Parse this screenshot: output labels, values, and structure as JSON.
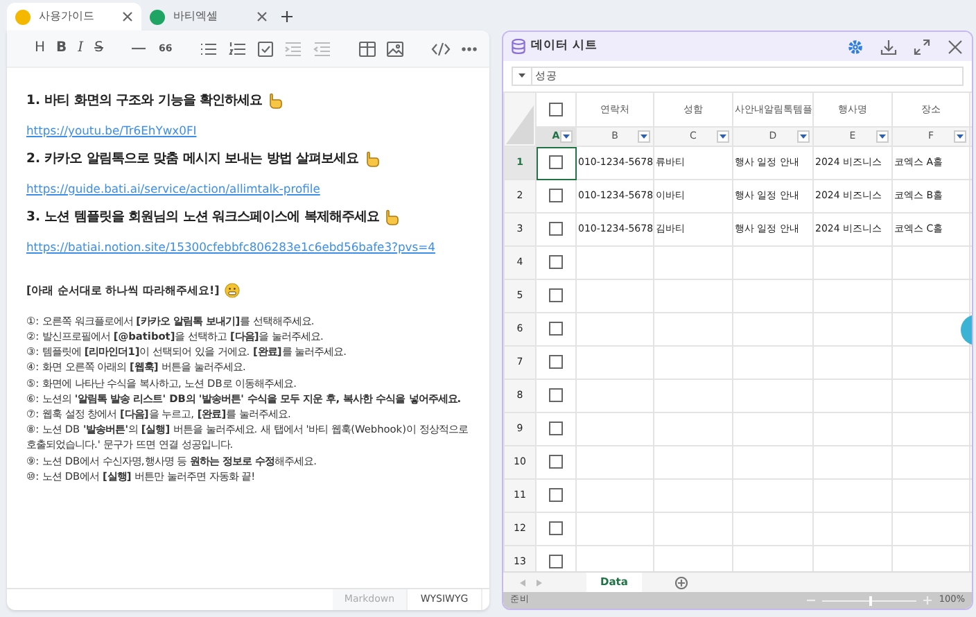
{
  "tabs": [
    {
      "label": "사용가이드",
      "selected": true,
      "color": "#f5b800"
    },
    {
      "label": "바티엑셀",
      "selected": false,
      "color": "#1fa463"
    }
  ],
  "editor": {
    "toolbar": [
      {
        "kind": "text",
        "label": "H"
      },
      {
        "kind": "bold",
        "label": "B"
      },
      {
        "kind": "italic",
        "label": "I"
      },
      {
        "kind": "strike",
        "label": "S"
      },
      {
        "kind": "sep"
      },
      {
        "kind": "line"
      },
      {
        "kind": "text",
        "label": "66"
      },
      {
        "kind": "sep"
      },
      {
        "kind": "bullet"
      },
      {
        "kind": "ordered"
      },
      {
        "kind": "task"
      },
      {
        "kind": "indent"
      },
      {
        "kind": "outdent"
      },
      {
        "kind": "sep"
      },
      {
        "kind": "table"
      },
      {
        "kind": "image"
      },
      {
        "kind": "sep"
      },
      {
        "kind": "code"
      },
      {
        "kind": "more"
      }
    ],
    "content": [
      {
        "kind": "heading",
        "text": "1. 바티 화면의 구조와 기능을 확인하세요"
      },
      {
        "kind": "link",
        "text": "https://youtu.be/Tr6EhYwx0FI"
      },
      {
        "kind": "heading",
        "text": "2. 카카오 알림톡으로 맞춤 메시지 보내는 방법 살펴보세요"
      },
      {
        "kind": "link",
        "text": "https://guide.bati.ai/service/action/allimtalk-profile"
      },
      {
        "kind": "heading",
        "text": "3. 노션 템플릿을 회원님의 노션 워크스페이스에 복제해주세요"
      },
      {
        "kind": "link",
        "text": "https://batiai.notion.site/15300cfebbfc806283e1c6ebd56bafe3?pvs=4"
      },
      {
        "kind": "note",
        "text": "[아래 순서대로 하나씩 따라해주세요!]"
      },
      {
        "kind": "step",
        "text": "①: 오른쪽 워크플로에서 **[카카오 알림톡 보내기]**를 선택해주세요."
      },
      {
        "kind": "step",
        "text": "②: 발신프로필에서 **[@batibot]**을 선택하고 **[다음]**을 눌러주세요."
      },
      {
        "kind": "step",
        "text": "③: 템플릿에 **[리마인더1]**이 선택되어 있을 거에요. **[완료]**를 눌러주세요."
      },
      {
        "kind": "step",
        "text": "④: 화면 오른쪽 아래의 **[웹훅]** 버튼을 눌러주세요."
      },
      {
        "kind": "step",
        "text": "⑤: 화면에 나타난 수식을 복사하고, 노션 DB로 이동해주세요."
      },
      {
        "kind": "step",
        "text": "⑥: 노션의 **'알림톡 발송 리스트' DB의 '발송버튼' 수식을 모두 지운 후, 복사한 수식을 넣어주세요.**"
      },
      {
        "kind": "step",
        "text": "⑦: 웹훅 설정 창에서 **[다음]**을 누르고, **[완료]**를 눌러주세요."
      },
      {
        "kind": "step",
        "text": "⑧: 노션 DB **'발송버튼'**의 **[실행]** 버튼을 눌러주세요. 새 탭에서 '바티 웹훅(Webhook)이 정상적으로 호출되었습니다.' 문구가 뜨면 연결 성공입니다."
      },
      {
        "kind": "step",
        "text": "⑨: 노션 DB에서 수신자명,행사명 등 **원하는 정보로 수정**해주세요."
      },
      {
        "kind": "step",
        "text": "⑩: 노션 DB에서 **[실행]** 버튼만 눌러주면 자동화 끝!"
      }
    ],
    "modes": [
      {
        "label": "Markdown",
        "selected": false
      },
      {
        "label": "WYSIWYG",
        "selected": true
      }
    ]
  },
  "sheet": {
    "title": "데이터 시트",
    "filter": "성공",
    "columns": [
      {
        "letter": "A",
        "kind": "check",
        "checked": false,
        "selected": true
      },
      {
        "letter": "B",
        "kind": "text",
        "name": "연락처",
        "selected": false
      },
      {
        "letter": "C",
        "kind": "text",
        "name": "성함",
        "selected": false
      },
      {
        "letter": "D",
        "kind": "text",
        "name": "사안내알림톡템플",
        "selected": false
      },
      {
        "letter": "E",
        "kind": "text",
        "name": "행사명",
        "selected": false
      },
      {
        "letter": "F",
        "kind": "text",
        "name": "장소",
        "selected": false
      }
    ],
    "rows": [
      {
        "number": "1",
        "selected": true,
        "checked": false,
        "cells": [
          "010-1234-5678",
          "류바티",
          "행사 일정 안내",
          "2024 비즈니스",
          "코엑스 A홀"
        ]
      },
      {
        "number": "2",
        "selected": false,
        "checked": false,
        "cells": [
          "010-1234-5678",
          "이바티",
          "행사 일정 안내",
          "2024 비즈니스",
          "코엑스 B홀"
        ]
      },
      {
        "number": "3",
        "selected": false,
        "checked": false,
        "cells": [
          "010-1234-5678",
          "김바티",
          "행사 일정 안내",
          "2024 비즈니스",
          "코엑스 C홀"
        ]
      },
      {
        "number": "4",
        "selected": false,
        "checked": false
      },
      {
        "number": "5",
        "selected": false,
        "checked": false
      },
      {
        "number": "6",
        "selected": false,
        "checked": false
      },
      {
        "number": "7",
        "selected": false,
        "checked": false
      },
      {
        "number": "8",
        "selected": false,
        "checked": false
      },
      {
        "number": "9",
        "selected": false,
        "checked": false
      },
      {
        "number": "10",
        "selected": false,
        "checked": false
      },
      {
        "number": "11",
        "selected": false,
        "checked": false
      },
      {
        "number": "12",
        "selected": false,
        "checked": false
      },
      {
        "number": "13",
        "selected": false,
        "checked": false
      }
    ],
    "sheet_tabs": [
      {
        "label": "Data",
        "selected": true
      }
    ],
    "status": "준비",
    "zoom": {
      "level": 0.5,
      "reading": "100%"
    }
  }
}
